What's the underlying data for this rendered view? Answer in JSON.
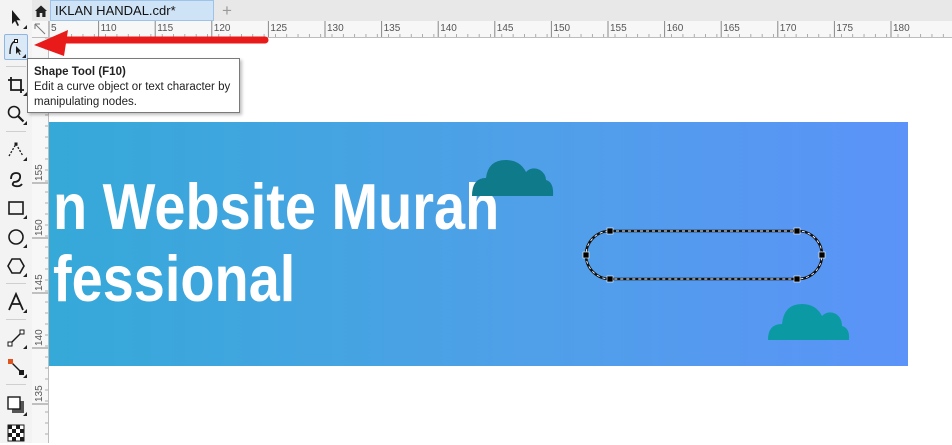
{
  "tab": {
    "title": "IKLAN HANDAL.cdr*",
    "add_label": "+"
  },
  "ruler": {
    "top_labels": [
      "5",
      "110",
      "115",
      "120",
      "125",
      "130",
      "135",
      "140",
      "145",
      "150",
      "155",
      "160",
      "165",
      "170",
      "175",
      "180"
    ],
    "left_labels": [
      "155",
      "150",
      "145",
      "140",
      "135"
    ]
  },
  "tooltip": {
    "title": "Shape Tool (F10)",
    "line1": "Edit a curve object or text character by",
    "line2": "manipulating nodes."
  },
  "banner": {
    "line1": "n Website Murah",
    "line2": "fessional"
  },
  "colors": {
    "banner_start": "#35a9d8",
    "banner_end": "#5b93f8",
    "cloud_dark": "#0e7a8a",
    "cloud_teal": "#0b9aa3",
    "arrow_red": "#e81a1a"
  },
  "tools": [
    {
      "icon": "pick-tool-icon"
    },
    {
      "icon": "shape-tool-icon"
    },
    {
      "icon": "crop-tool-icon"
    },
    {
      "icon": "zoom-tool-icon"
    },
    {
      "icon": "freehand-tool-icon"
    },
    {
      "icon": "artistic-media-icon"
    },
    {
      "icon": "rectangle-tool-icon"
    },
    {
      "icon": "ellipse-tool-icon"
    },
    {
      "icon": "polygon-tool-icon"
    },
    {
      "icon": "text-tool-icon"
    },
    {
      "icon": "connector-tool-icon"
    },
    {
      "icon": "interactive-fill-icon"
    },
    {
      "icon": "drop-shadow-icon"
    },
    {
      "icon": "transparency-icon"
    }
  ]
}
